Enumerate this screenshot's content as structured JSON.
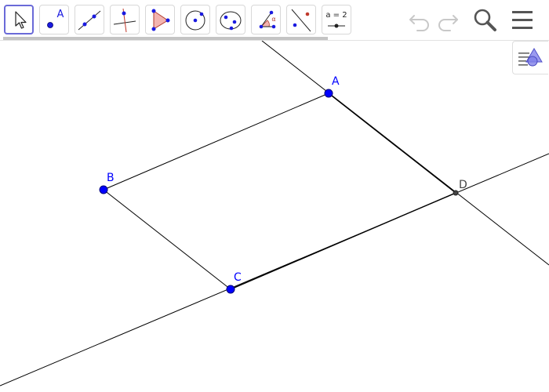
{
  "toolbar": {
    "tools": [
      {
        "name": "move-tool",
        "label": ""
      },
      {
        "name": "point-tool",
        "label": "A"
      },
      {
        "name": "line-tool",
        "label": ""
      },
      {
        "name": "perpendicular-line-tool",
        "label": ""
      },
      {
        "name": "polygon-tool",
        "label": ""
      },
      {
        "name": "circle-tool",
        "label": ""
      },
      {
        "name": "conic-tool",
        "label": ""
      },
      {
        "name": "angle-tool",
        "label": "α"
      },
      {
        "name": "reflect-tool",
        "label": ""
      },
      {
        "name": "slider-tool",
        "label": "a = 2"
      }
    ],
    "actions": [
      "undo-icon",
      "redo-icon",
      "search-icon",
      "menu-icon"
    ]
  },
  "points": {
    "A": {
      "label": "A",
      "color": "#0000ff"
    },
    "B": {
      "label": "B",
      "color": "#0000ff"
    },
    "C": {
      "label": "C",
      "color": "#0000ff"
    },
    "D": {
      "label": "D",
      "color": "#444444"
    }
  },
  "colors": {
    "accent": "#6a6ad8",
    "free_point": "#0000ff",
    "dependent_point": "#444444",
    "line": "#000000"
  }
}
